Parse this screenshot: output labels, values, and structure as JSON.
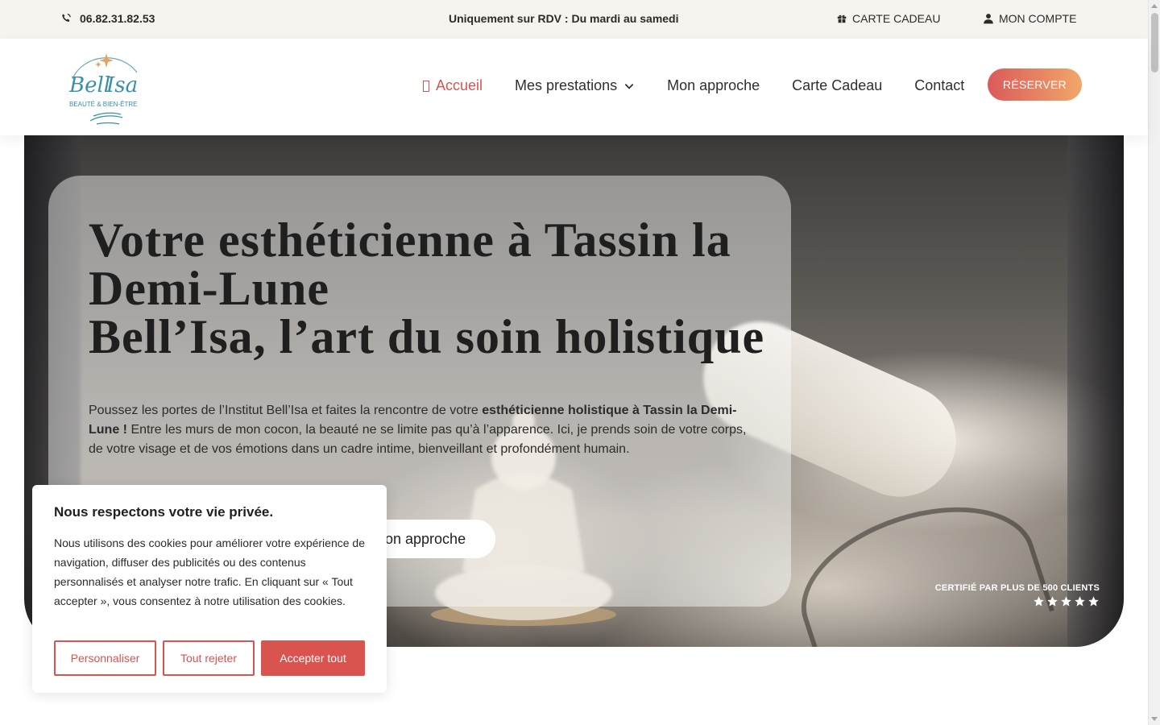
{
  "topbar": {
    "phone": "06.82.31.82.53",
    "hours": "Uniquement sur RDV : Du mardi au samedi",
    "gift_card": "CARTE CADEAU",
    "account": "MON COMPTE"
  },
  "header": {
    "logo": {
      "name": "Bell'Isa",
      "tagline": "BEAUTÉ & BIEN-ÊTRE"
    },
    "nav": {
      "home": "Accueil",
      "services": "Mes prestations",
      "approach": "Mon approche",
      "gift_card": "Carte Cadeau",
      "contact": "Contact"
    },
    "reserve_button": "RÉSERVER"
  },
  "hero": {
    "title_line1": "Votre esthéticienne à Tassin la Demi-Lune",
    "title_line2": "Bell’Isa, l’art du soin holistique",
    "text_part1": "Poussez les portes de l’Institut Bell’Isa et faites la rencontre de votre ",
    "text_bold": "esthéticienne holistique à Tassin la Demi-Lune !",
    "text_part2": " Entre les murs de mon cocon, la beauté ne se limite pas qu’à l’apparence. Ici, je prends soin de votre corps, de votre visage et de vos émotions dans un cadre intime, bienveillant et profondément humain.",
    "approach_button": "on approche",
    "certified": "CERTIFIÉ PAR PLUS DE 500 CLIENTS",
    "rating_stars": 5
  },
  "cookie_banner": {
    "title": "Nous respectons votre vie privée.",
    "text": "Nous utilisons des cookies pour améliorer votre expérience de navigation, diffuser des publicités ou des contenus personnalisés et analyser notre trafic. En cliquant sur « Tout accepter », vous consentez à notre utilisation des cookies.",
    "customize": "Personnaliser",
    "reject": "Tout rejeter",
    "accept": "Accepter tout"
  },
  "colors": {
    "accent": "#d9534f",
    "gradient_start": "#db5a5a",
    "gradient_end": "#f1a76a",
    "topbar_bg": "#f7f3ee"
  }
}
